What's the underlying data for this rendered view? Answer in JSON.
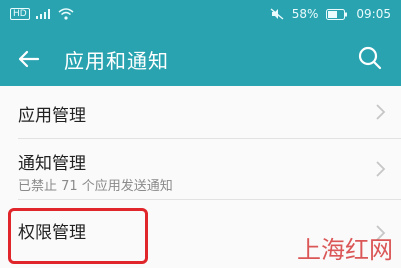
{
  "status_bar": {
    "left_badge": "HD",
    "battery": "58%",
    "time": "09:05",
    "icons": [
      "signal-icon",
      "wifi-icon",
      "mute-icon",
      "battery-icon"
    ]
  },
  "app_bar": {
    "title": "应用和通知",
    "back_icon": "back-arrow-icon",
    "search_icon": "search-icon",
    "color": "#2aa3b0"
  },
  "items": [
    {
      "label": "应用管理",
      "sub": ""
    },
    {
      "label": "通知管理",
      "sub": "已禁止 71 个应用发送通知"
    },
    {
      "label": "权限管理",
      "sub": ""
    }
  ],
  "annotation": {
    "highlight_color": "#e0262b"
  },
  "watermark": "上海红网"
}
